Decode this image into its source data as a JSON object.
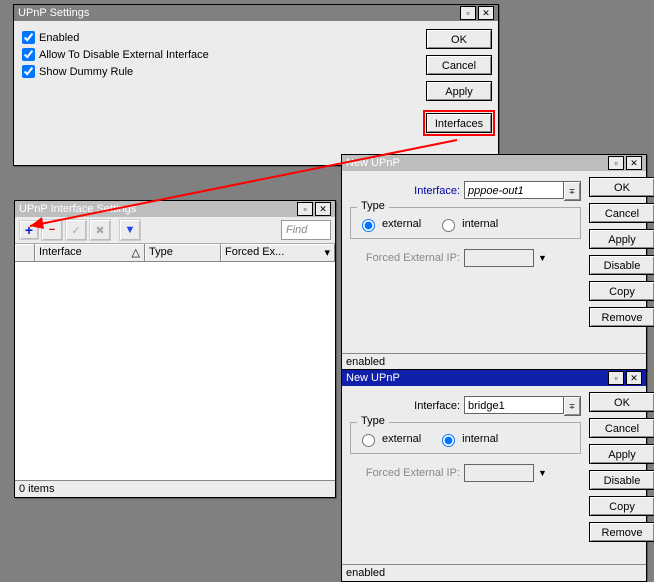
{
  "settings": {
    "title": "UPnP Settings",
    "chk_enabled": "Enabled",
    "chk_allow": "Allow To Disable External Interface",
    "chk_dummy": "Show Dummy Rule",
    "btn_ok": "OK",
    "btn_cancel": "Cancel",
    "btn_apply": "Apply",
    "btn_interfaces": "Interfaces"
  },
  "iflist": {
    "title": "UPnP Interface Settings",
    "find": "Find",
    "col_mark": " ",
    "col_interface": "Interface",
    "col_type": "Type",
    "col_forced": "Forced Ex...",
    "status": "0 items"
  },
  "new1": {
    "title": "New UPnP",
    "lbl_interface": "Interface:",
    "val_interface": "pppoe-out1",
    "grp_type": "Type",
    "radio_ext": "external",
    "radio_int": "internal",
    "lbl_forced": "Forced External IP:",
    "btn_ok": "OK",
    "btn_cancel": "Cancel",
    "btn_apply": "Apply",
    "btn_disable": "Disable",
    "btn_copy": "Copy",
    "btn_remove": "Remove",
    "status": "enabled"
  },
  "new2": {
    "title": "New UPnP",
    "lbl_interface": "Interface:",
    "val_interface": "bridge1",
    "grp_type": "Type",
    "radio_ext": "external",
    "radio_int": "internal",
    "lbl_forced": "Forced External IP:",
    "btn_ok": "OK",
    "btn_cancel": "Cancel",
    "btn_apply": "Apply",
    "btn_disable": "Disable",
    "btn_copy": "Copy",
    "btn_remove": "Remove",
    "status": "enabled"
  }
}
